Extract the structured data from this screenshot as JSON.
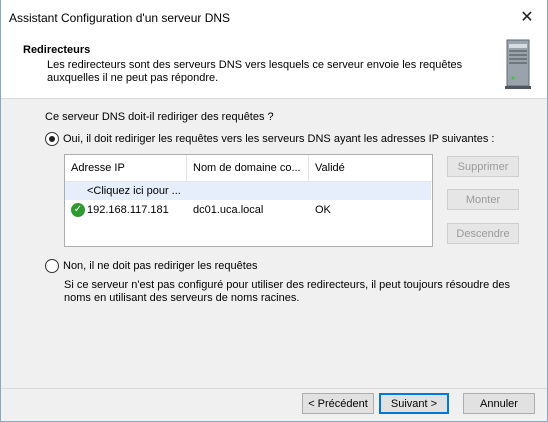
{
  "window": {
    "title": "Assistant Configuration d'un serveur DNS",
    "close_glyph": "✕"
  },
  "header": {
    "title": "Redirecteurs",
    "description": "Les redirecteurs sont des serveurs DNS vers lesquels ce serveur envoie les requêtes auxquelles il ne peut pas répondre.",
    "icon": "server-icon"
  },
  "main": {
    "question": "Ce serveur DNS doit-il rediriger des requêtes ?",
    "option_yes": "Oui, il doit rediriger les requêtes vers les serveurs DNS ayant les adresses IP suivantes :",
    "option_no": "Non, il ne doit pas rediriger les requêtes",
    "selected": "yes",
    "note": "Si ce serveur n'est pas configuré pour utiliser des redirecteurs, il peut toujours résoudre des noms en utilisant des serveurs de noms racines."
  },
  "list": {
    "columns": [
      "Adresse IP",
      "Nom de domaine co...",
      "Validé"
    ],
    "placeholder": "<Cliquez ici pour ...",
    "rows": [
      {
        "ip": "192.168.117.181",
        "domain": "dc01.uca.local",
        "status": "OK",
        "icon": "check-circle-icon"
      }
    ]
  },
  "side_buttons": {
    "remove": "Supprimer",
    "up": "Monter",
    "down": "Descendre"
  },
  "footer": {
    "back": "< Précédent",
    "next": "Suivant >",
    "cancel": "Annuler"
  },
  "colors": {
    "accent": "#0078d7",
    "success": "#2f9a2f",
    "placeholder_row": "#e5eefa"
  }
}
